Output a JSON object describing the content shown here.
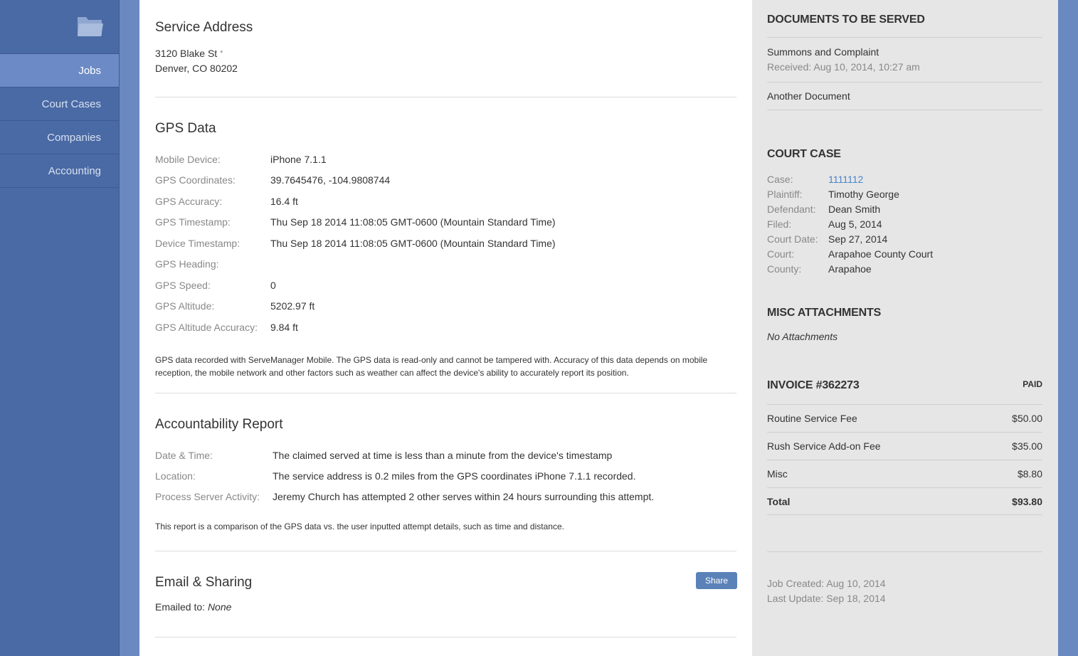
{
  "sidebar": {
    "items": [
      {
        "label": "Jobs"
      },
      {
        "label": "Court Cases"
      },
      {
        "label": "Companies"
      },
      {
        "label": "Accounting"
      }
    ]
  },
  "service_address": {
    "title": "Service Address",
    "line1": "3120 Blake St",
    "asterisk": "*",
    "line2": "Denver, CO 80202"
  },
  "gps": {
    "title": "GPS Data",
    "rows": [
      {
        "label": "Mobile Device:",
        "value": "iPhone 7.1.1"
      },
      {
        "label": "GPS Coordinates:",
        "value": "39.7645476, -104.9808744"
      },
      {
        "label": "GPS Accuracy:",
        "value": "16.4 ft"
      },
      {
        "label": "GPS Timestamp:",
        "value": "Thu Sep 18 2014 11:08:05 GMT-0600 (Mountain Standard Time)"
      },
      {
        "label": "Device Timestamp:",
        "value": "Thu Sep 18 2014 11:08:05 GMT-0600 (Mountain Standard Time)"
      },
      {
        "label": "GPS Heading:",
        "value": ""
      },
      {
        "label": "GPS Speed:",
        "value": "0"
      },
      {
        "label": "GPS Altitude:",
        "value": "5202.97 ft"
      },
      {
        "label": "GPS Altitude Accuracy:",
        "value": "9.84 ft"
      }
    ],
    "note": "GPS data recorded with ServeManager Mobile. The GPS data is read-only and cannot be tampered with. Accuracy of this data depends on mobile reception, the mobile network and other factors such as weather can affect the device's ability to accurately report its position."
  },
  "accountability": {
    "title": "Accountability Report",
    "rows": [
      {
        "label": "Date & Time:",
        "value": "The claimed served at time is less than a minute from the device's timestamp"
      },
      {
        "label": "Location:",
        "value": "The service address is 0.2 miles from the GPS coordinates iPhone 7.1.1 recorded."
      },
      {
        "label": "Process Server Activity:",
        "value": "Jeremy Church has attempted 2 other serves within 24 hours surrounding this attempt."
      }
    ],
    "note": "This report is a comparison of the GPS data vs. the user inputted attempt details, such as time and distance."
  },
  "email": {
    "title": "Email & Sharing",
    "share_label": "Share",
    "emailed_label": "Emailed to:",
    "emailed_value": "None"
  },
  "documents": {
    "title": "DOCUMENTS TO BE SERVED",
    "items": [
      {
        "name": "Summons and Complaint",
        "received": "Received: Aug 10, 2014, 10:27 am"
      },
      {
        "name": "Another Document",
        "received": ""
      }
    ]
  },
  "court_case": {
    "title": "COURT CASE",
    "rows": [
      {
        "label": "Case:",
        "value": "1111112"
      },
      {
        "label": "Plaintiff:",
        "value": "Timothy George"
      },
      {
        "label": "Defendant:",
        "value": "Dean Smith"
      },
      {
        "label": "Filed:",
        "value": "Aug 5, 2014"
      },
      {
        "label": "Court Date:",
        "value": "Sep 27, 2014"
      },
      {
        "label": "Court:",
        "value": "Arapahoe County Court"
      },
      {
        "label": "County:",
        "value": "Arapahoe"
      }
    ]
  },
  "misc": {
    "title": "MISC ATTACHMENTS",
    "empty": "No Attachments"
  },
  "invoice": {
    "title": "INVOICE #362273",
    "status": "PAID",
    "lines": [
      {
        "label": "Routine Service Fee",
        "amount": "$50.00"
      },
      {
        "label": "Rush Service Add-on Fee",
        "amount": "$35.00"
      },
      {
        "label": "Misc",
        "amount": "$8.80"
      }
    ],
    "total_label": "Total",
    "total_amount": "$93.80"
  },
  "job_meta": {
    "created": "Job Created: Aug 10, 2014",
    "updated": "Last Update: Sep 18, 2014"
  },
  "colors": {
    "sidebar": "#4a6aa5",
    "active_nav": "#6c8bc6",
    "link": "#4a84c9",
    "button": "#5b82b8"
  }
}
